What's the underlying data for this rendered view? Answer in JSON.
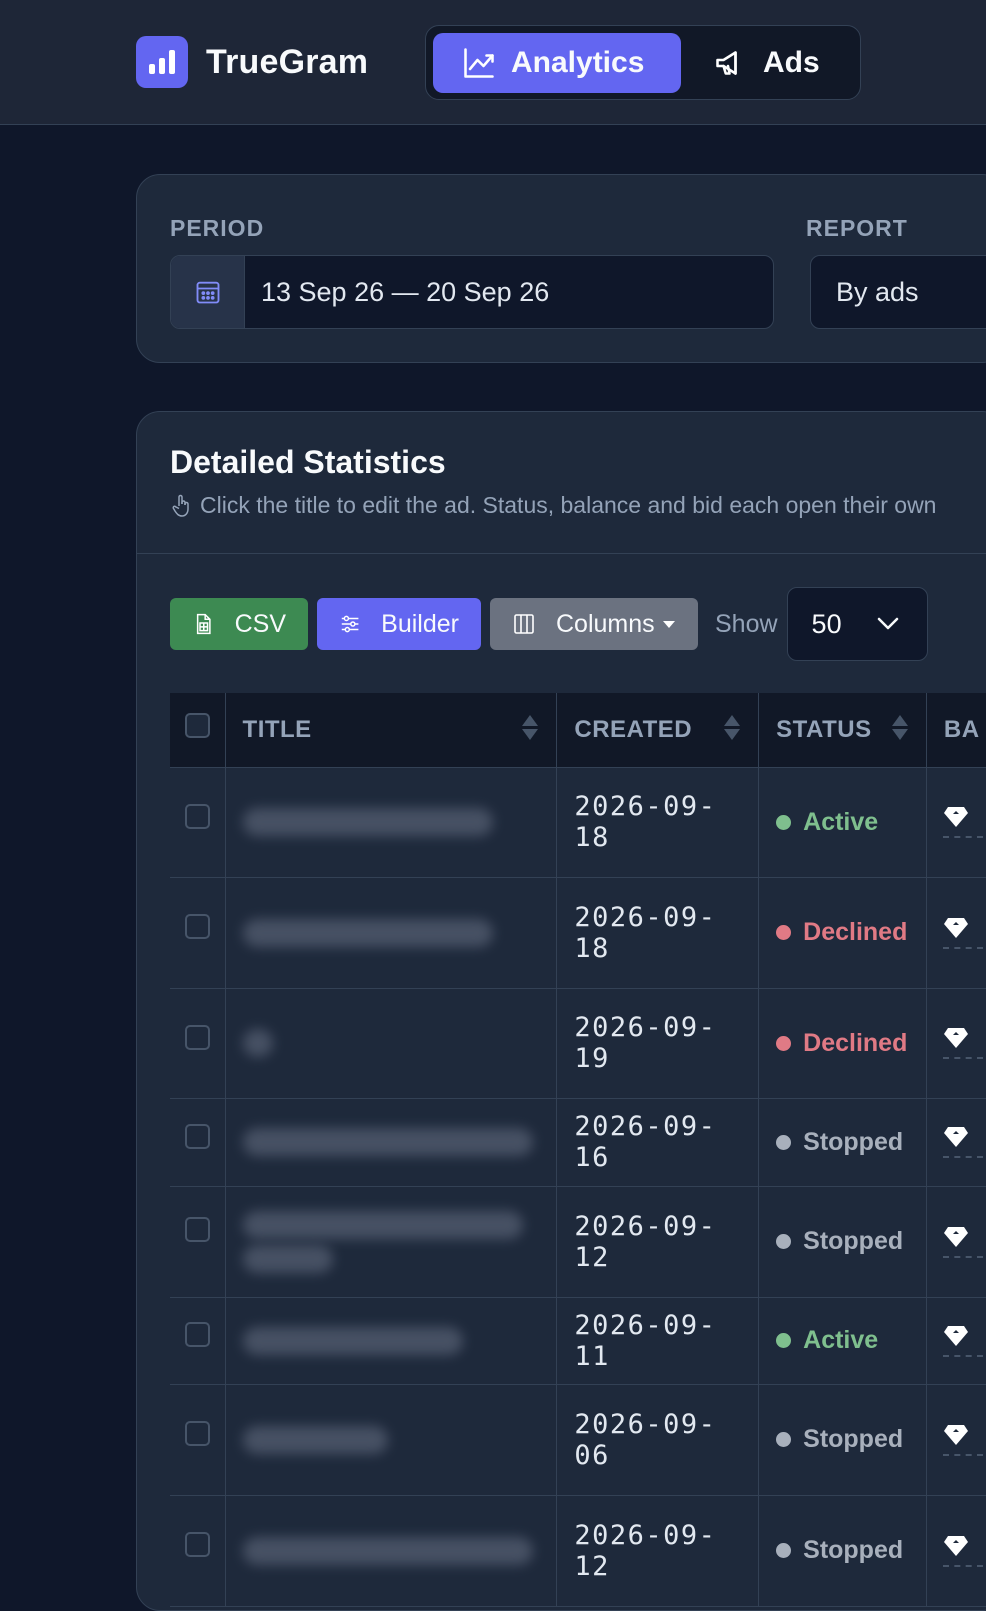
{
  "app": {
    "name": "TrueGram"
  },
  "nav": {
    "analytics_label": "Analytics",
    "ads_label": "Ads"
  },
  "filters": {
    "period_label": "PERIOD",
    "period_value": "13 Sep 26 — 20 Sep 26",
    "report_label": "REPORT",
    "report_value": "By ads"
  },
  "stats": {
    "title": "Detailed Statistics",
    "hint": "Click the title to edit the ad. Status, balance and bid each open their own"
  },
  "toolbar": {
    "csv_label": "CSV",
    "builder_label": "Builder",
    "columns_label": "Columns",
    "show_label": "Show",
    "show_value": "50"
  },
  "table": {
    "headers": {
      "title": "TITLE",
      "created": "CREATED",
      "status": "STATUS",
      "balance": "BA"
    },
    "rows": [
      {
        "created": "2026-09-18",
        "status": "Active"
      },
      {
        "created": "2026-09-18",
        "status": "Declined"
      },
      {
        "created": "2026-09-19",
        "status": "Declined"
      },
      {
        "created": "2026-09-16",
        "status": "Stopped"
      },
      {
        "created": "2026-09-12",
        "status": "Stopped"
      },
      {
        "created": "2026-09-11",
        "status": "Active"
      },
      {
        "created": "2026-09-06",
        "status": "Stopped"
      },
      {
        "created": "2026-09-12",
        "status": "Stopped"
      }
    ]
  },
  "colors": {
    "accent": "#6366f1",
    "active": "#7fbf8e",
    "declined": "#e07a85",
    "stopped": "#a8b0bc"
  }
}
